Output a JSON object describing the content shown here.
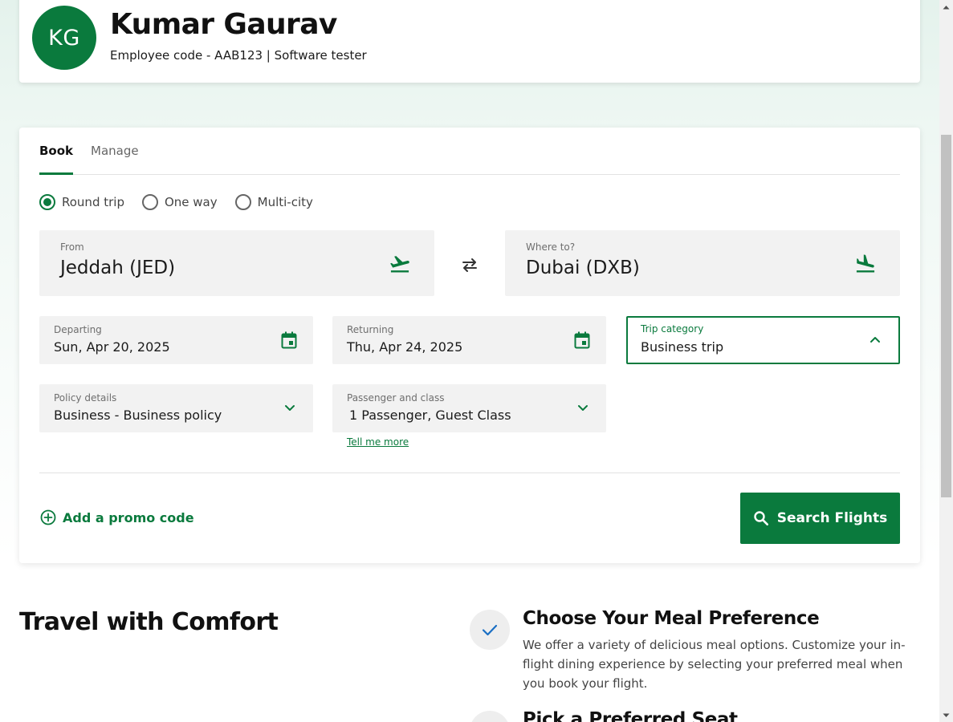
{
  "profile": {
    "initials": "KG",
    "name": "Kumar Gaurav",
    "subtitle": "Employee code - AAB123 | Software tester"
  },
  "tabs": [
    {
      "label": "Book",
      "active": true
    },
    {
      "label": "Manage",
      "active": false
    }
  ],
  "trip_types": [
    {
      "label": "Round trip",
      "selected": true
    },
    {
      "label": "One way",
      "selected": false
    },
    {
      "label": "Multi-city",
      "selected": false
    }
  ],
  "from": {
    "label": "From",
    "value": "Jeddah (JED)",
    "icon": "plane-takeoff-icon"
  },
  "to": {
    "label": "Where to?",
    "value": "Dubai (DXB)",
    "icon": "plane-landing-icon"
  },
  "departing": {
    "label": "Departing",
    "value": "Sun, Apr 20, 2025",
    "icon": "calendar-icon"
  },
  "returning": {
    "label": "Returning",
    "value": "Thu, Apr 24, 2025",
    "icon": "calendar-icon"
  },
  "trip_category": {
    "label": "Trip category",
    "value": "Business trip"
  },
  "policy": {
    "label": "Policy details",
    "value": "Business - Business policy"
  },
  "passenger": {
    "label": "Passenger and class",
    "value": "1 Passenger, Guest Class",
    "link": "Tell me more"
  },
  "promo_label": "Add a promo code",
  "search_label": "Search Flights",
  "comfort": {
    "title": "Travel with Comfort",
    "features": [
      {
        "title": "Choose Your Meal Preference",
        "desc": "We offer a variety of delicious meal options. Customize your in-flight dining experience by selecting your preferred meal when you book your flight."
      },
      {
        "title": "Pick a Preferred Seat",
        "desc": ""
      }
    ]
  },
  "colors": {
    "brand_green": "#0a7a3d",
    "field_bg": "#f2f2f2",
    "check_blue": "#1a6fc4"
  }
}
